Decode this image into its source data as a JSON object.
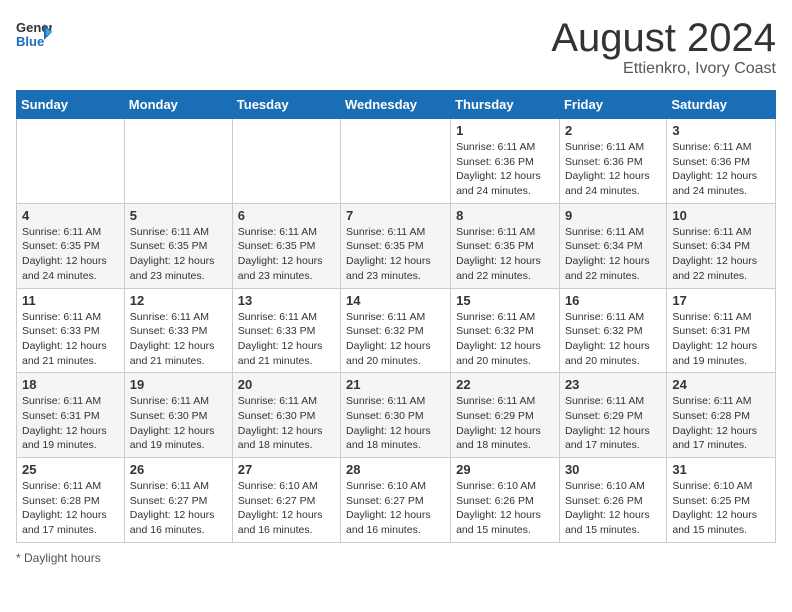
{
  "logo": {
    "line1": "General",
    "line2": "Blue"
  },
  "title": "August 2024",
  "subtitle": "Ettienkro, Ivory Coast",
  "days_of_week": [
    "Sunday",
    "Monday",
    "Tuesday",
    "Wednesday",
    "Thursday",
    "Friday",
    "Saturday"
  ],
  "footer": {
    "label": "Daylight hours"
  },
  "weeks": [
    [
      {
        "day": "",
        "info": ""
      },
      {
        "day": "",
        "info": ""
      },
      {
        "day": "",
        "info": ""
      },
      {
        "day": "",
        "info": ""
      },
      {
        "day": "1",
        "info": "Sunrise: 6:11 AM\nSunset: 6:36 PM\nDaylight: 12 hours\nand 24 minutes."
      },
      {
        "day": "2",
        "info": "Sunrise: 6:11 AM\nSunset: 6:36 PM\nDaylight: 12 hours\nand 24 minutes."
      },
      {
        "day": "3",
        "info": "Sunrise: 6:11 AM\nSunset: 6:36 PM\nDaylight: 12 hours\nand 24 minutes."
      }
    ],
    [
      {
        "day": "4",
        "info": "Sunrise: 6:11 AM\nSunset: 6:35 PM\nDaylight: 12 hours\nand 24 minutes."
      },
      {
        "day": "5",
        "info": "Sunrise: 6:11 AM\nSunset: 6:35 PM\nDaylight: 12 hours\nand 23 minutes."
      },
      {
        "day": "6",
        "info": "Sunrise: 6:11 AM\nSunset: 6:35 PM\nDaylight: 12 hours\nand 23 minutes."
      },
      {
        "day": "7",
        "info": "Sunrise: 6:11 AM\nSunset: 6:35 PM\nDaylight: 12 hours\nand 23 minutes."
      },
      {
        "day": "8",
        "info": "Sunrise: 6:11 AM\nSunset: 6:35 PM\nDaylight: 12 hours\nand 22 minutes."
      },
      {
        "day": "9",
        "info": "Sunrise: 6:11 AM\nSunset: 6:34 PM\nDaylight: 12 hours\nand 22 minutes."
      },
      {
        "day": "10",
        "info": "Sunrise: 6:11 AM\nSunset: 6:34 PM\nDaylight: 12 hours\nand 22 minutes."
      }
    ],
    [
      {
        "day": "11",
        "info": "Sunrise: 6:11 AM\nSunset: 6:33 PM\nDaylight: 12 hours\nand 21 minutes."
      },
      {
        "day": "12",
        "info": "Sunrise: 6:11 AM\nSunset: 6:33 PM\nDaylight: 12 hours\nand 21 minutes."
      },
      {
        "day": "13",
        "info": "Sunrise: 6:11 AM\nSunset: 6:33 PM\nDaylight: 12 hours\nand 21 minutes."
      },
      {
        "day": "14",
        "info": "Sunrise: 6:11 AM\nSunset: 6:32 PM\nDaylight: 12 hours\nand 20 minutes."
      },
      {
        "day": "15",
        "info": "Sunrise: 6:11 AM\nSunset: 6:32 PM\nDaylight: 12 hours\nand 20 minutes."
      },
      {
        "day": "16",
        "info": "Sunrise: 6:11 AM\nSunset: 6:32 PM\nDaylight: 12 hours\nand 20 minutes."
      },
      {
        "day": "17",
        "info": "Sunrise: 6:11 AM\nSunset: 6:31 PM\nDaylight: 12 hours\nand 19 minutes."
      }
    ],
    [
      {
        "day": "18",
        "info": "Sunrise: 6:11 AM\nSunset: 6:31 PM\nDaylight: 12 hours\nand 19 minutes."
      },
      {
        "day": "19",
        "info": "Sunrise: 6:11 AM\nSunset: 6:30 PM\nDaylight: 12 hours\nand 19 minutes."
      },
      {
        "day": "20",
        "info": "Sunrise: 6:11 AM\nSunset: 6:30 PM\nDaylight: 12 hours\nand 18 minutes."
      },
      {
        "day": "21",
        "info": "Sunrise: 6:11 AM\nSunset: 6:30 PM\nDaylight: 12 hours\nand 18 minutes."
      },
      {
        "day": "22",
        "info": "Sunrise: 6:11 AM\nSunset: 6:29 PM\nDaylight: 12 hours\nand 18 minutes."
      },
      {
        "day": "23",
        "info": "Sunrise: 6:11 AM\nSunset: 6:29 PM\nDaylight: 12 hours\nand 17 minutes."
      },
      {
        "day": "24",
        "info": "Sunrise: 6:11 AM\nSunset: 6:28 PM\nDaylight: 12 hours\nand 17 minutes."
      }
    ],
    [
      {
        "day": "25",
        "info": "Sunrise: 6:11 AM\nSunset: 6:28 PM\nDaylight: 12 hours\nand 17 minutes."
      },
      {
        "day": "26",
        "info": "Sunrise: 6:11 AM\nSunset: 6:27 PM\nDaylight: 12 hours\nand 16 minutes."
      },
      {
        "day": "27",
        "info": "Sunrise: 6:10 AM\nSunset: 6:27 PM\nDaylight: 12 hours\nand 16 minutes."
      },
      {
        "day": "28",
        "info": "Sunrise: 6:10 AM\nSunset: 6:27 PM\nDaylight: 12 hours\nand 16 minutes."
      },
      {
        "day": "29",
        "info": "Sunrise: 6:10 AM\nSunset: 6:26 PM\nDaylight: 12 hours\nand 15 minutes."
      },
      {
        "day": "30",
        "info": "Sunrise: 6:10 AM\nSunset: 6:26 PM\nDaylight: 12 hours\nand 15 minutes."
      },
      {
        "day": "31",
        "info": "Sunrise: 6:10 AM\nSunset: 6:25 PM\nDaylight: 12 hours\nand 15 minutes."
      }
    ]
  ]
}
